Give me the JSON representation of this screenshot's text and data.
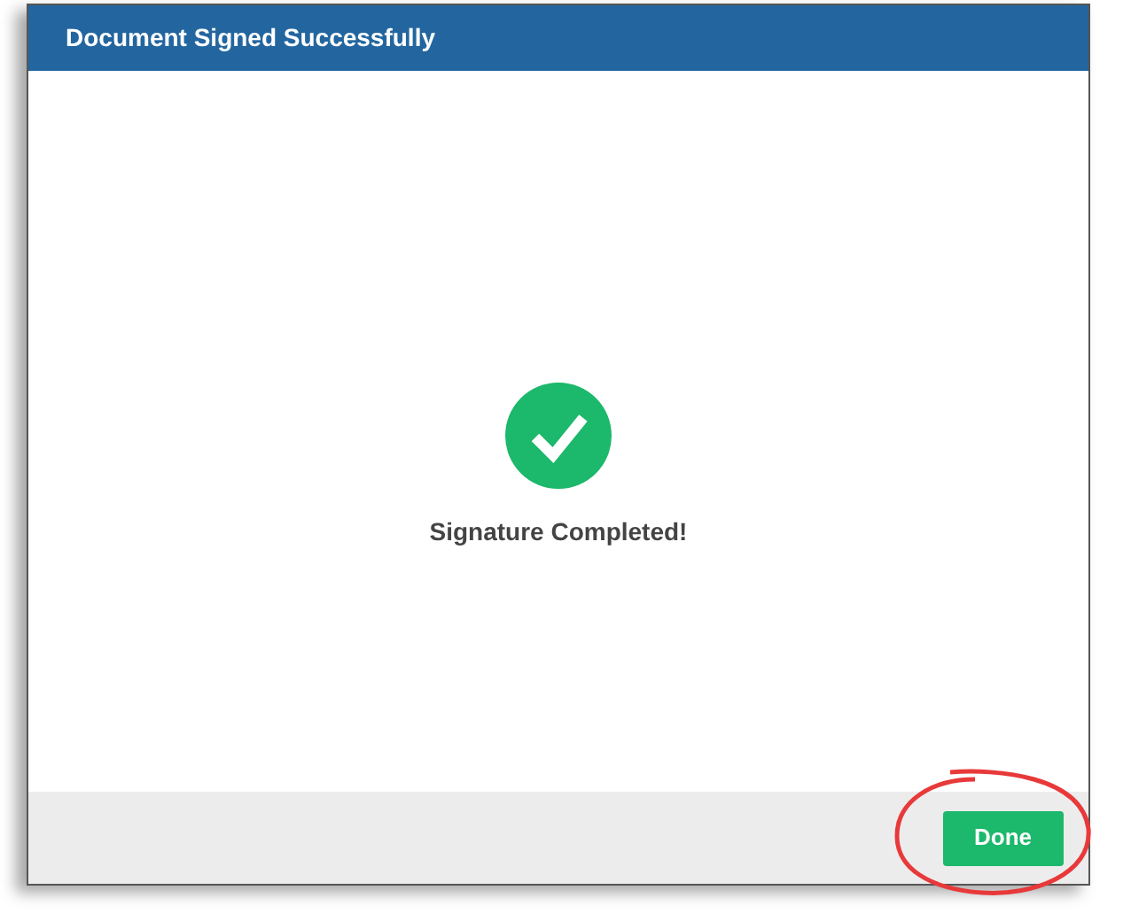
{
  "dialog": {
    "title": "Document Signed Successfully",
    "message": "Signature Completed!",
    "buttons": [
      {
        "label": "Done",
        "kind": "primary"
      }
    ]
  },
  "annotation": {
    "kind": "circle",
    "color": "#e8393a"
  }
}
